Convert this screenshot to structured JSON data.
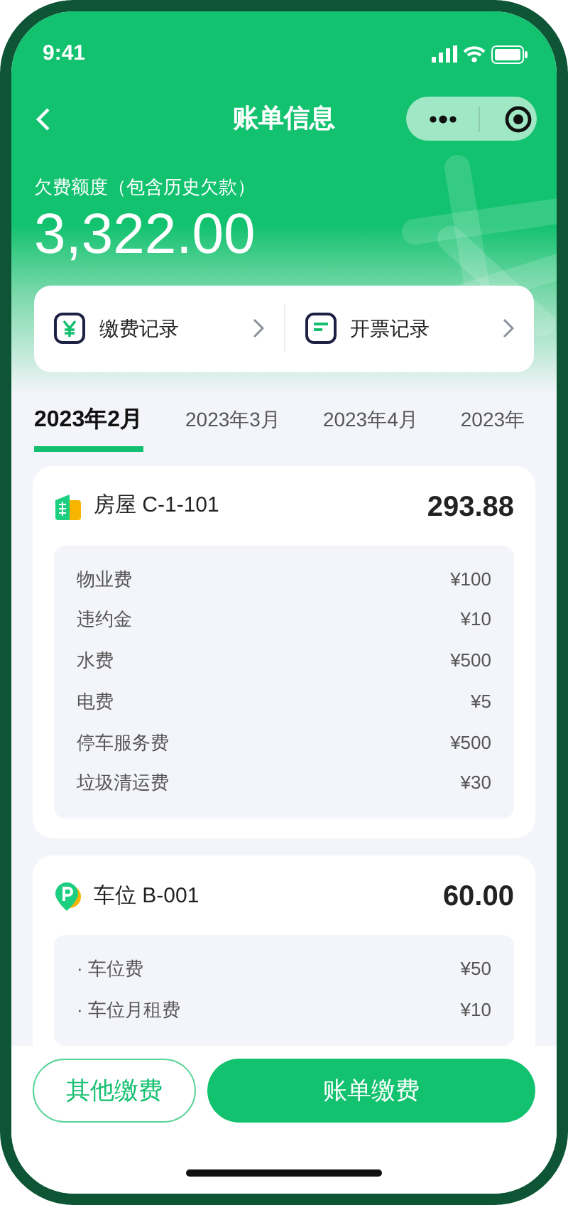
{
  "status_bar": {
    "time": "9:41"
  },
  "nav": {
    "title": "账单信息"
  },
  "balance": {
    "label": "欠费额度（包含历史欠款）",
    "amount": "3,322.00"
  },
  "records": [
    {
      "kind": "payment",
      "label": "缴费记录"
    },
    {
      "kind": "invoice",
      "label": "开票记录"
    }
  ],
  "tabs": [
    {
      "label": "2023年2月",
      "selected": true
    },
    {
      "label": "2023年3月",
      "selected": false
    },
    {
      "label": "2023年4月",
      "selected": false
    },
    {
      "label": "2023年",
      "selected": false
    }
  ],
  "bills": [
    {
      "kind": "house",
      "title": "房屋 C-1-101",
      "total": "293.88",
      "items": [
        {
          "label": "物业费",
          "amount": "¥100"
        },
        {
          "label": "违约金",
          "amount": "¥10"
        },
        {
          "label": "水费",
          "amount": "¥500"
        },
        {
          "label": "电费",
          "amount": "¥5"
        },
        {
          "label": "停车服务费",
          "amount": "¥500"
        },
        {
          "label": "垃圾清运费",
          "amount": "¥30"
        }
      ]
    },
    {
      "kind": "parking",
      "title": "车位 B-001",
      "total": "60.00",
      "items": [
        {
          "label": "· 车位费",
          "amount": "¥50"
        },
        {
          "label": "· 车位月租费",
          "amount": "¥10"
        }
      ]
    }
  ],
  "buttons": [
    {
      "kind": "secondary",
      "label": "其他缴费"
    },
    {
      "kind": "primary",
      "label": "账单缴费"
    }
  ]
}
